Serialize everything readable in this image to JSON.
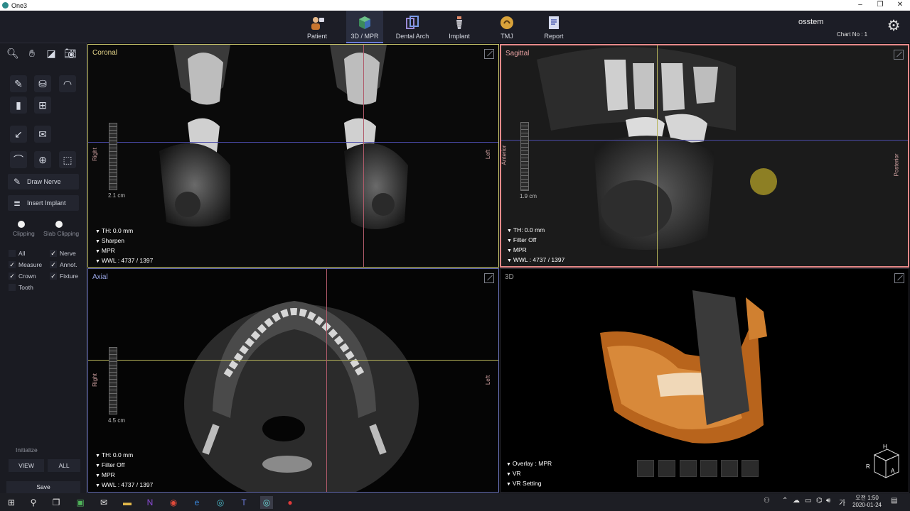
{
  "window": {
    "title": "One3",
    "minimize": "–",
    "maximize": "❐",
    "close": "✕"
  },
  "nav": {
    "tabs": [
      {
        "label": "Patient"
      },
      {
        "label": "3D / MPR"
      },
      {
        "label": "Dental Arch"
      },
      {
        "label": "Implant"
      },
      {
        "label": "TMJ"
      },
      {
        "label": "Report"
      }
    ],
    "user": "osstem",
    "chart_no": "Chart No : 1"
  },
  "sidebar": {
    "draw_nerve": "Draw Nerve",
    "insert_implant": "Insert Implant",
    "clipping": "Clipping",
    "slab_clipping": "Slab Clipping",
    "checks": {
      "all": "All",
      "nerve": "Nerve",
      "measure": "Measure",
      "annot": "Annot.",
      "crown": "Crown",
      "fixture": "Fixture",
      "tooth": "Tooth"
    },
    "initialize": "Initialize",
    "view_btn": "VIEW",
    "all_btn": "ALL",
    "save": "Save"
  },
  "views": {
    "coronal": {
      "title": "Coronal",
      "left_orient": "Right",
      "right_orient": "Left",
      "ruler": "2.1 cm",
      "info": [
        "TH: 0.0 mm",
        "Sharpen",
        "MPR",
        "WWL : 4737 / 1397"
      ]
    },
    "sagittal": {
      "title": "Sagittal",
      "left_orient": "Anterior",
      "right_orient": "Posterior",
      "ruler": "1.9 cm",
      "info": [
        "TH: 0.0 mm",
        "Filter Off",
        "MPR",
        "WWL : 4737 / 1397"
      ]
    },
    "axial": {
      "title": "Axial",
      "left_orient": "Right",
      "right_orient": "Left",
      "ruler": "4.5 cm",
      "info": [
        "TH: 0.0 mm",
        "Filter Off",
        "MPR",
        "WWL : 4737 / 1397"
      ]
    },
    "vr3d": {
      "title": "3D",
      "info": [
        "Overlay : MPR",
        "VR",
        "VR Setting"
      ],
      "cube": {
        "top": "H",
        "left": "R",
        "front": "A"
      }
    }
  },
  "taskbar": {
    "time": "오전 1:50",
    "date": "2020-01-24",
    "lang": "가"
  },
  "colors": {
    "accent": "#6a7bd6",
    "sagittal_border": "#e88a8a",
    "coronal_title": "#e6d68a",
    "sagittal_title": "#e6a0a0",
    "axial_title": "#9aa7e6",
    "vr_title": "#9a9a9a",
    "bone": "#d88a3a"
  }
}
